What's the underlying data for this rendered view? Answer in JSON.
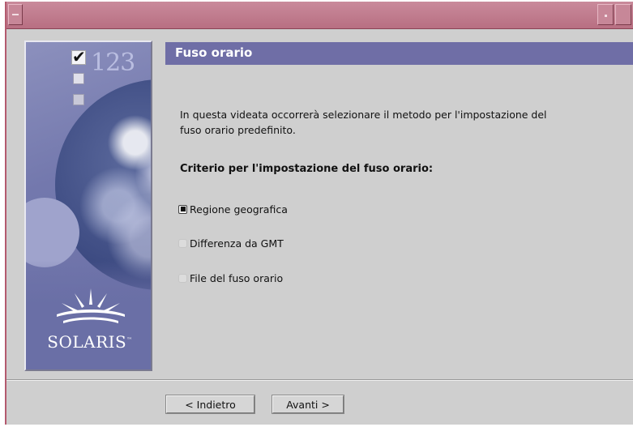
{
  "window": {
    "title": "",
    "colors": {
      "titlebar": "#b86f82",
      "header_band": "#6f6ea6",
      "background": "#cfcfcf",
      "side_panel": "#7378ad"
    }
  },
  "sidebar": {
    "steps_number": "123",
    "brand": "SOLARIS",
    "brand_mark": "™"
  },
  "header": {
    "title": "Fuso orario"
  },
  "main": {
    "instruction": "In questa videata occorrerà selezionare il metodo per l'impostazione del fuso orario predefinito.",
    "criteria_label": "Criterio per l'impostazione del fuso orario:",
    "options": [
      {
        "label": "Regione geografica",
        "selected": true
      },
      {
        "label": "Differenza da GMT",
        "selected": false
      },
      {
        "label": "File del fuso orario",
        "selected": false
      }
    ]
  },
  "footer": {
    "back_label": "< Indietro",
    "next_label": "Avanti >"
  }
}
